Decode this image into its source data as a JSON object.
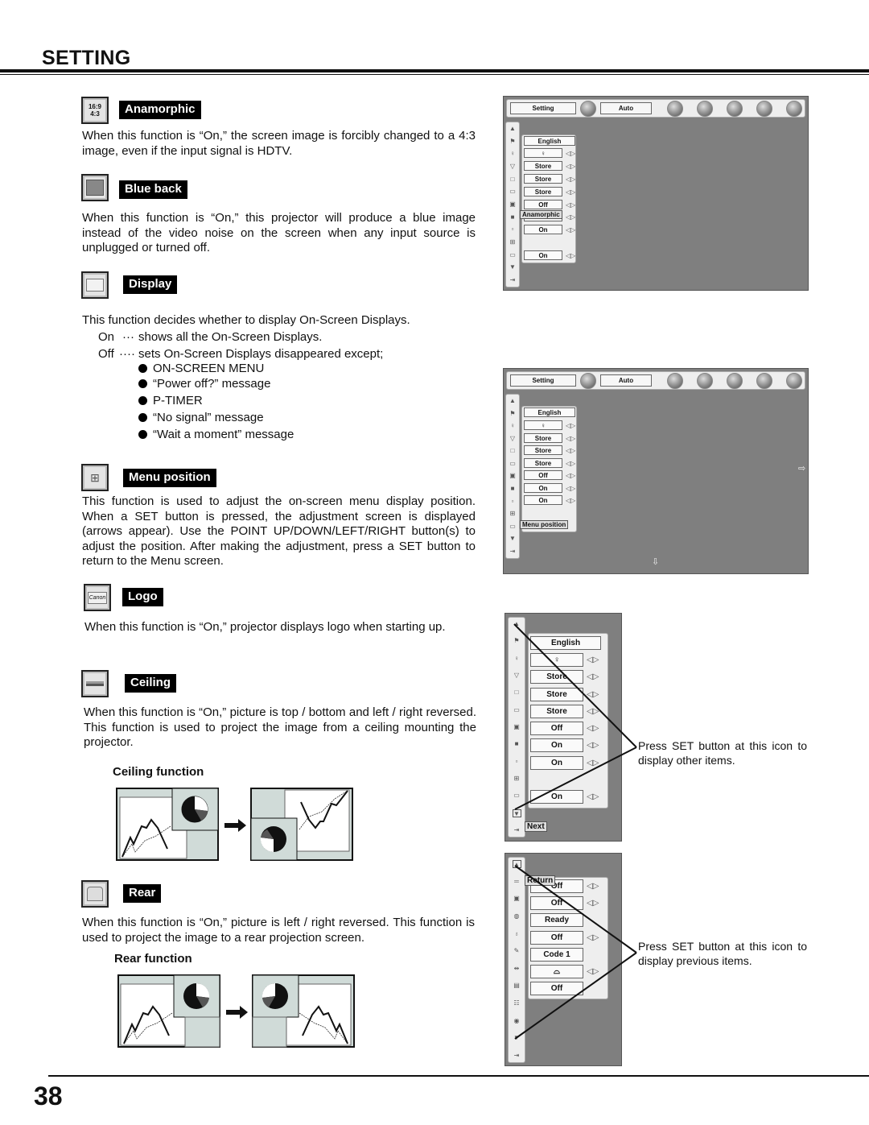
{
  "page": {
    "title": "SETTING",
    "number": "38"
  },
  "sections": {
    "anamorphic": {
      "label": "Anamorphic",
      "icon": "anamorphic-16-9-4-3-icon",
      "text": "When this function is “On,” the screen image is forcibly changed to a 4:3 image, even if the input signal is HDTV."
    },
    "blue_back": {
      "label": "Blue back",
      "icon": "blue-back-icon",
      "text": "When this function is “On,” this projector will produce a blue image instead of the video noise on the screen when any input source is unplugged or turned off."
    },
    "display": {
      "label": "Display",
      "icon": "display-icon",
      "intro": "This function decides whether to display On-Screen Displays.",
      "on_label": "On",
      "on_dots": "···",
      "on_text": "shows all the On-Screen Displays.",
      "off_label": "Off",
      "off_dots": "····",
      "off_text": "sets On-Screen Displays disappeared except;",
      "bullets": [
        "ON-SCREEN MENU",
        "“Power off?” message",
        "P-TIMER",
        "“No signal” message",
        "“Wait a moment” message"
      ]
    },
    "menu_position": {
      "label": "Menu position",
      "icon": "menu-position-icon",
      "text": "This function is used to adjust the on-screen menu display position. When a SET button is pressed, the adjustment screen is displayed (arrows appear). Use the POINT UP/DOWN/LEFT/RIGHT button(s) to adjust the position. After making the adjustment, press a SET button to return to the Menu screen."
    },
    "logo": {
      "label": "Logo",
      "icon": "logo-icon",
      "icon_text": "Canon",
      "text": "When this function is “On,” projector displays logo when starting up."
    },
    "ceiling": {
      "label": "Ceiling",
      "icon": "ceiling-icon",
      "text": "When this function is “On,” picture is top / bottom and left / right reversed.  This function is used to project the image from a ceiling mounting the projector.",
      "figure_title": "Ceiling function"
    },
    "rear": {
      "label": "Rear",
      "icon": "rear-icon",
      "text": "When this function is “On,” picture is left / right reversed.  This function is used to project the image to a rear projection screen.",
      "figure_title": "Rear function"
    }
  },
  "osd1": {
    "menu_button": "Setting",
    "mode_button": "Auto",
    "values": [
      "English",
      "♀",
      "Store",
      "Store",
      "Store",
      "Off",
      "",
      "On",
      "",
      "On"
    ],
    "tooltip": "Anamorphic"
  },
  "osd2": {
    "menu_button": "Setting",
    "mode_button": "Auto",
    "values": [
      "English",
      "♀",
      "Store",
      "Store",
      "Store",
      "Off",
      "On",
      "On",
      "",
      ""
    ],
    "tooltip": "Menu position",
    "arrow_right": "⇨",
    "arrow_down": "⇩"
  },
  "osd3": {
    "values": [
      "English",
      "♀",
      "Store",
      "Store",
      "Store",
      "Off",
      "On",
      "On",
      "",
      "On"
    ],
    "tooltip": "Next",
    "callout": "Press SET button at this icon to display other items."
  },
  "osd4": {
    "values": [
      "Off",
      "Off",
      "Ready",
      "Off",
      "Code 1",
      "⌓",
      "Off"
    ],
    "tooltip": "Return",
    "callout": "Press SET button at this icon to display previous items."
  },
  "glyphs": {
    "up": "▲",
    "down": "▼",
    "lr": "◁▷",
    "exit": "⇥",
    "right_arrow": "➡"
  }
}
